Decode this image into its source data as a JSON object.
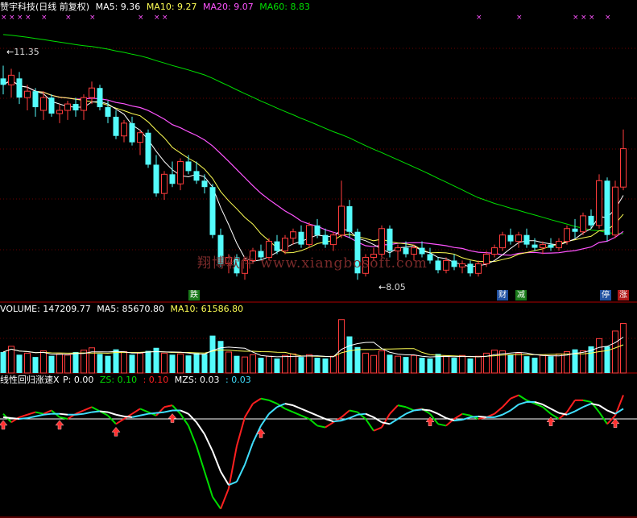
{
  "header": {
    "stock_title": "赞宇科技(日线 前复权)",
    "ma5": "MA5: 9.36",
    "ma10": "MA10: 9.27",
    "ma20": "MA20: 9.07",
    "ma60": "MA60: 8.83"
  },
  "volume_header": {
    "volume": "VOLUME: 147209.77",
    "ma5": "MA5: 85670.80",
    "ma10": "MA10: 61586.80"
  },
  "indicator_header": {
    "name": "线性回归涨速X",
    "p": "P: 0.00",
    "zs": "ZS: 0.10",
    "zs2": ": 0.10",
    "mzs": "MZS: 0.03",
    "mzs2": ": 0.03"
  },
  "annotations": {
    "high_label": "11.35",
    "low_label": "8.05",
    "watermark": "翔博软件 www.xiangbosoft.com"
  },
  "badges": [
    {
      "text": "跌",
      "bg": "#1a7a1a"
    },
    {
      "text": "财",
      "bg": "#2050a0"
    },
    {
      "text": "减",
      "bg": "#1a7a1a"
    },
    {
      "text": "停",
      "bg": "#2050a0"
    },
    {
      "text": "涨",
      "bg": "#b01818"
    }
  ],
  "colors": {
    "up": "#ff3c3c",
    "down": "#54fcfc",
    "ma5": "#ffffff",
    "ma10": "#ffff54",
    "ma20": "#ff54ff",
    "ma60": "#00e000",
    "frame": "#b00000",
    "zs_up": "#ff2020",
    "zs_down": "#00dd00",
    "mzs_a": "#ffffff",
    "mzs_b": "#40e0ff"
  },
  "chart_data": {
    "type": "candlestick",
    "price_range": [
      7.7,
      12.2
    ],
    "candles": [
      {
        "o": 11.2,
        "h": 11.4,
        "l": 10.95,
        "c": 11.1
      },
      {
        "o": 11.1,
        "h": 11.35,
        "l": 10.9,
        "c": 11.25
      },
      {
        "o": 11.2,
        "h": 11.3,
        "l": 10.8,
        "c": 10.9
      },
      {
        "o": 10.9,
        "h": 11.1,
        "l": 10.7,
        "c": 11.0
      },
      {
        "o": 11.0,
        "h": 11.05,
        "l": 10.6,
        "c": 10.75
      },
      {
        "o": 10.7,
        "h": 11.0,
        "l": 10.55,
        "c": 10.9
      },
      {
        "o": 10.9,
        "h": 10.95,
        "l": 10.6,
        "c": 10.65
      },
      {
        "o": 10.65,
        "h": 10.8,
        "l": 10.5,
        "c": 10.7
      },
      {
        "o": 10.7,
        "h": 10.85,
        "l": 10.55,
        "c": 10.8
      },
      {
        "o": 10.8,
        "h": 10.9,
        "l": 10.6,
        "c": 10.7
      },
      {
        "o": 10.7,
        "h": 10.95,
        "l": 10.55,
        "c": 10.9
      },
      {
        "o": 10.9,
        "h": 11.15,
        "l": 10.8,
        "c": 11.05
      },
      {
        "o": 11.05,
        "h": 11.1,
        "l": 10.7,
        "c": 10.75
      },
      {
        "o": 10.75,
        "h": 10.85,
        "l": 10.5,
        "c": 10.6
      },
      {
        "o": 10.6,
        "h": 10.7,
        "l": 10.25,
        "c": 10.3
      },
      {
        "o": 10.3,
        "h": 10.55,
        "l": 10.2,
        "c": 10.5
      },
      {
        "o": 10.5,
        "h": 10.6,
        "l": 10.15,
        "c": 10.2
      },
      {
        "o": 10.2,
        "h": 10.4,
        "l": 10.0,
        "c": 10.35
      },
      {
        "o": 10.35,
        "h": 10.4,
        "l": 9.8,
        "c": 9.85
      },
      {
        "o": 9.85,
        "h": 10.0,
        "l": 9.35,
        "c": 9.4
      },
      {
        "o": 9.4,
        "h": 9.75,
        "l": 9.3,
        "c": 9.7
      },
      {
        "o": 9.7,
        "h": 9.9,
        "l": 9.5,
        "c": 9.55
      },
      {
        "o": 9.55,
        "h": 9.95,
        "l": 9.45,
        "c": 9.9
      },
      {
        "o": 9.9,
        "h": 10.0,
        "l": 9.7,
        "c": 9.75
      },
      {
        "o": 9.75,
        "h": 9.9,
        "l": 9.55,
        "c": 9.6
      },
      {
        "o": 9.6,
        "h": 9.7,
        "l": 9.4,
        "c": 9.5
      },
      {
        "o": 9.5,
        "h": 9.55,
        "l": 8.7,
        "c": 8.75
      },
      {
        "o": 8.75,
        "h": 8.85,
        "l": 8.25,
        "c": 8.3
      },
      {
        "o": 8.3,
        "h": 8.45,
        "l": 8.15,
        "c": 8.4
      },
      {
        "o": 8.4,
        "h": 8.45,
        "l": 8.1,
        "c": 8.15
      },
      {
        "o": 8.15,
        "h": 8.4,
        "l": 8.05,
        "c": 8.35
      },
      {
        "o": 8.35,
        "h": 8.55,
        "l": 8.3,
        "c": 8.5
      },
      {
        "o": 8.5,
        "h": 8.6,
        "l": 8.35,
        "c": 8.4
      },
      {
        "o": 8.4,
        "h": 8.7,
        "l": 8.35,
        "c": 8.65
      },
      {
        "o": 8.65,
        "h": 8.75,
        "l": 8.45,
        "c": 8.5
      },
      {
        "o": 8.5,
        "h": 8.75,
        "l": 8.45,
        "c": 8.7
      },
      {
        "o": 8.7,
        "h": 8.85,
        "l": 8.6,
        "c": 8.8
      },
      {
        "o": 8.8,
        "h": 8.9,
        "l": 8.55,
        "c": 8.6
      },
      {
        "o": 8.6,
        "h": 8.95,
        "l": 8.55,
        "c": 8.9
      },
      {
        "o": 8.9,
        "h": 9.0,
        "l": 8.7,
        "c": 8.75
      },
      {
        "o": 8.75,
        "h": 8.85,
        "l": 8.55,
        "c": 8.6
      },
      {
        "o": 8.6,
        "h": 8.8,
        "l": 8.5,
        "c": 8.75
      },
      {
        "o": 8.75,
        "h": 9.6,
        "l": 8.7,
        "c": 9.2
      },
      {
        "o": 9.2,
        "h": 9.3,
        "l": 8.7,
        "c": 8.8
      },
      {
        "o": 8.8,
        "h": 8.85,
        "l": 8.05,
        "c": 8.15
      },
      {
        "o": 8.15,
        "h": 8.45,
        "l": 8.1,
        "c": 8.4
      },
      {
        "o": 8.4,
        "h": 8.55,
        "l": 8.35,
        "c": 8.45
      },
      {
        "o": 8.45,
        "h": 8.9,
        "l": 8.4,
        "c": 8.85
      },
      {
        "o": 8.85,
        "h": 8.9,
        "l": 8.4,
        "c": 8.5
      },
      {
        "o": 8.5,
        "h": 8.6,
        "l": 8.35,
        "c": 8.55
      },
      {
        "o": 8.55,
        "h": 8.65,
        "l": 8.4,
        "c": 8.45
      },
      {
        "o": 8.45,
        "h": 8.6,
        "l": 8.35,
        "c": 8.55
      },
      {
        "o": 8.55,
        "h": 8.65,
        "l": 8.4,
        "c": 8.45
      },
      {
        "o": 8.45,
        "h": 8.55,
        "l": 8.3,
        "c": 8.35
      },
      {
        "o": 8.35,
        "h": 8.4,
        "l": 8.15,
        "c": 8.2
      },
      {
        "o": 8.2,
        "h": 8.4,
        "l": 8.15,
        "c": 8.35
      },
      {
        "o": 8.35,
        "h": 8.45,
        "l": 8.2,
        "c": 8.25
      },
      {
        "o": 8.25,
        "h": 8.35,
        "l": 8.15,
        "c": 8.3
      },
      {
        "o": 8.3,
        "h": 8.35,
        "l": 8.1,
        "c": 8.15
      },
      {
        "o": 8.15,
        "h": 8.35,
        "l": 8.1,
        "c": 8.3
      },
      {
        "o": 8.3,
        "h": 8.5,
        "l": 8.25,
        "c": 8.45
      },
      {
        "o": 8.45,
        "h": 8.6,
        "l": 8.4,
        "c": 8.55
      },
      {
        "o": 8.55,
        "h": 8.8,
        "l": 8.5,
        "c": 8.75
      },
      {
        "o": 8.75,
        "h": 8.85,
        "l": 8.6,
        "c": 8.65
      },
      {
        "o": 8.65,
        "h": 8.8,
        "l": 8.55,
        "c": 8.75
      },
      {
        "o": 8.75,
        "h": 8.85,
        "l": 8.55,
        "c": 8.6
      },
      {
        "o": 8.6,
        "h": 8.7,
        "l": 8.5,
        "c": 8.55
      },
      {
        "o": 8.55,
        "h": 8.65,
        "l": 8.45,
        "c": 8.6
      },
      {
        "o": 8.6,
        "h": 8.7,
        "l": 8.5,
        "c": 8.55
      },
      {
        "o": 8.55,
        "h": 8.7,
        "l": 8.5,
        "c": 8.65
      },
      {
        "o": 8.65,
        "h": 8.9,
        "l": 8.6,
        "c": 8.85
      },
      {
        "o": 8.85,
        "h": 9.0,
        "l": 8.7,
        "c": 8.8
      },
      {
        "o": 8.8,
        "h": 9.1,
        "l": 8.75,
        "c": 9.05
      },
      {
        "o": 9.05,
        "h": 9.15,
        "l": 8.85,
        "c": 8.9
      },
      {
        "o": 8.9,
        "h": 9.7,
        "l": 8.85,
        "c": 9.6
      },
      {
        "o": 9.6,
        "h": 9.65,
        "l": 8.65,
        "c": 8.75
      },
      {
        "o": 8.75,
        "h": 9.6,
        "l": 8.7,
        "c": 9.5
      },
      {
        "o": 9.5,
        "h": 10.4,
        "l": 9.45,
        "c": 10.1
      }
    ],
    "volumes": [
      55,
      70,
      48,
      52,
      42,
      58,
      45,
      50,
      47,
      55,
      60,
      66,
      50,
      45,
      62,
      56,
      48,
      52,
      58,
      66,
      52,
      48,
      50,
      46,
      52,
      50,
      98,
      84,
      55,
      45,
      42,
      48,
      40,
      44,
      38,
      46,
      50,
      42,
      48,
      40,
      38,
      44,
      140,
      96,
      68,
      52,
      46,
      58,
      48,
      44,
      42,
      46,
      40,
      38,
      50,
      44,
      40,
      46,
      38,
      44,
      52,
      60,
      58,
      48,
      52,
      44,
      40,
      46,
      44,
      50,
      56,
      62,
      58,
      70,
      90,
      70,
      110,
      130
    ],
    "volume_range": [
      0,
      150
    ],
    "indicator": {
      "zs": [
        0.4,
        -0.1,
        0.2,
        0.35,
        0.5,
        0.4,
        0.6,
        0.2,
        0.1,
        0.4,
        0.6,
        0.8,
        0.55,
        0.3,
        -0.2,
        0.1,
        0.4,
        0.7,
        0.5,
        0.3,
        0.8,
        0.9,
        0.4,
        -0.3,
        -1.5,
        -3.0,
        -4.5,
        -5.2,
        -4.0,
        -1.5,
        0.2,
        1.0,
        1.3,
        1.2,
        1.0,
        0.7,
        0.5,
        0.3,
        0.1,
        -0.3,
        -0.4,
        -0.1,
        0.2,
        0.6,
        0.5,
        0.1,
        -0.6,
        -0.4,
        0.4,
        0.9,
        0.8,
        0.6,
        0.7,
        0.4,
        -0.2,
        -0.3,
        0.1,
        0.4,
        0.3,
        0.1,
        0.2,
        0.4,
        0.8,
        1.3,
        1.5,
        1.2,
        1.0,
        0.8,
        0.4,
        0.1,
        0.5,
        1.2,
        1.2,
        1.1,
        0.5,
        -0.2,
        0.3,
        1.5
      ],
      "mzs": [
        0.2,
        0.15,
        0.1,
        0.15,
        0.25,
        0.35,
        0.4,
        0.4,
        0.35,
        0.35,
        0.4,
        0.5,
        0.55,
        0.5,
        0.35,
        0.25,
        0.2,
        0.3,
        0.4,
        0.45,
        0.5,
        0.6,
        0.6,
        0.4,
        -0.1,
        -0.8,
        -1.8,
        -3.0,
        -3.8,
        -3.6,
        -2.6,
        -1.3,
        -0.3,
        0.4,
        0.8,
        1.0,
        0.9,
        0.7,
        0.5,
        0.3,
        0.1,
        -0.05,
        0.0,
        0.15,
        0.35,
        0.4,
        0.2,
        -0.1,
        -0.2,
        0.1,
        0.4,
        0.6,
        0.65,
        0.6,
        0.4,
        0.15,
        0.0,
        0.05,
        0.2,
        0.25,
        0.2,
        0.2,
        0.35,
        0.6,
        0.95,
        1.1,
        1.1,
        0.95,
        0.7,
        0.45,
        0.35,
        0.55,
        0.8,
        1.0,
        0.9,
        0.6,
        0.4,
        0.7
      ],
      "range": [
        -5.6,
        2.0
      ]
    },
    "buy_arrow_indices": [
      0,
      7,
      14,
      21,
      32,
      53,
      68,
      76
    ],
    "pink_x_indices": [
      0,
      1,
      2,
      3,
      5,
      8,
      11,
      17,
      19,
      20,
      59,
      64,
      71,
      72,
      73,
      75
    ]
  }
}
